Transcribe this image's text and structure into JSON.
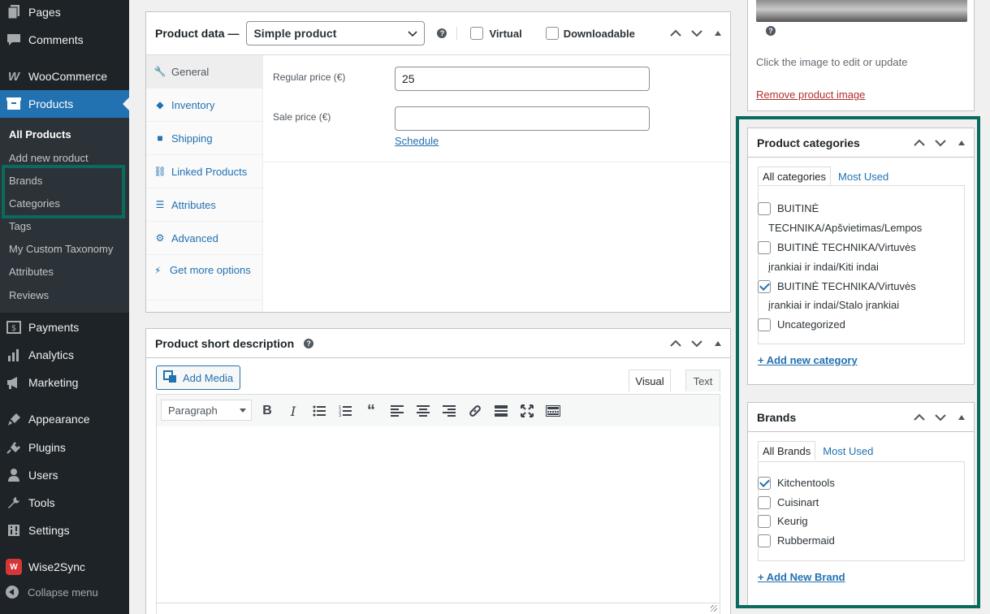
{
  "sidebar": {
    "menu": [
      {
        "label": "Pages",
        "icon": "pages-icon"
      },
      {
        "label": "Comments",
        "icon": "comments-icon"
      },
      {
        "label": "WooCommerce",
        "icon": "woocommerce-icon"
      },
      {
        "label": "Products",
        "icon": "products-icon"
      },
      {
        "label": "Payments",
        "icon": "payments-icon"
      },
      {
        "label": "Analytics",
        "icon": "analytics-icon"
      },
      {
        "label": "Marketing",
        "icon": "marketing-icon"
      },
      {
        "label": "Appearance",
        "icon": "appearance-icon"
      },
      {
        "label": "Plugins",
        "icon": "plugins-icon"
      },
      {
        "label": "Users",
        "icon": "users-icon"
      },
      {
        "label": "Tools",
        "icon": "tools-icon"
      },
      {
        "label": "Settings",
        "icon": "settings-icon"
      },
      {
        "label": "Wise2Sync",
        "icon": "wise2sync-icon"
      }
    ],
    "submenu": [
      "All Products",
      "Add new product",
      "Brands",
      "Categories",
      "Tags",
      "My Custom Taxonomy",
      "Attributes",
      "Reviews"
    ],
    "collapse_label": "Collapse menu"
  },
  "product_data": {
    "title": "Product data —",
    "type_value": "Simple product",
    "virtual_label": "Virtual",
    "downloadable_label": "Downloadable",
    "tabs": [
      "General",
      "Inventory",
      "Shipping",
      "Linked Products",
      "Attributes",
      "Advanced",
      "Get more options"
    ],
    "regular_price_label": "Regular price (€)",
    "regular_price_value": "25",
    "sale_price_label": "Sale price (€)",
    "sale_price_value": "",
    "schedule_label": "Schedule"
  },
  "short_description": {
    "title": "Product short description",
    "add_media_label": "Add Media",
    "visual_tab": "Visual",
    "text_tab": "Text",
    "format_value": "Paragraph"
  },
  "image_box": {
    "hint": "Click the image to edit or update",
    "remove_label": "Remove product image"
  },
  "categories": {
    "title": "Product categories",
    "tab_all": "All categories",
    "tab_most_used": "Most Used",
    "items": [
      {
        "label_line1": "BUITINĖ",
        "label_line2": "TECHNIKA/Apšvietimas/Lempos",
        "checked": false
      },
      {
        "label_line1": "BUITINĖ TECHNIKA/Virtuvės",
        "label_line2": "įrankiai ir indai/Kiti indai",
        "checked": false
      },
      {
        "label_line1": "BUITINĖ TECHNIKA/Virtuvės",
        "label_line2": "įrankiai ir indai/Stalo įrankiai",
        "checked": true
      },
      {
        "label_line1": "Uncategorized",
        "label_line2": "",
        "checked": false
      }
    ],
    "add_label": "+ Add new category"
  },
  "brands": {
    "title": "Brands",
    "tab_all": "All Brands",
    "tab_most_used": "Most Used",
    "items": [
      {
        "label": "Kitchentools",
        "checked": true
      },
      {
        "label": "Cuisinart",
        "checked": false
      },
      {
        "label": "Keurig",
        "checked": false
      },
      {
        "label": "Rubbermaid",
        "checked": false
      }
    ],
    "add_label": "+ Add New Brand"
  },
  "colors": {
    "sidebar_bg": "#1d2327",
    "active_blue": "#2271b1",
    "highlight_teal": "#0a6a5e",
    "link": "#2271b1"
  }
}
